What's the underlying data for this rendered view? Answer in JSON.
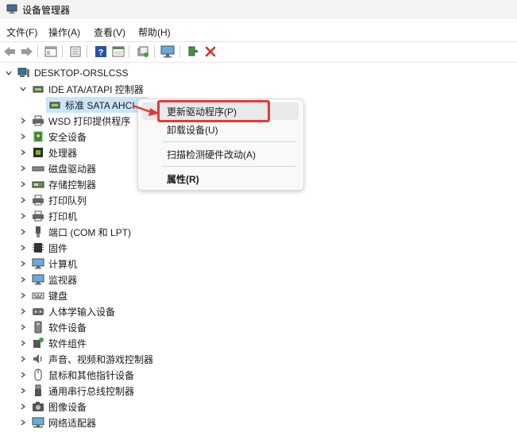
{
  "window": {
    "title": "设备管理器"
  },
  "menubar": {
    "items": [
      "文件(F)",
      "操作(A)",
      "查看(V)",
      "帮助(H)"
    ]
  },
  "toolbar": {
    "buttons": [
      "back-icon",
      "forward-icon",
      "properties-icon",
      "list-icon",
      "help-icon",
      "view-icon",
      "scan-icon",
      "monitor-icon",
      "enable-driver-icon",
      "uninstall-icon"
    ]
  },
  "tree": {
    "root": "DESKTOP-ORSLCSS",
    "ide_category": "IDE ATA/ATAPI 控制器",
    "ide_child": "标准 SATA AHCI",
    "categories": [
      "WSD 打印提供程序",
      "安全设备",
      "处理器",
      "磁盘驱动器",
      "存储控制器",
      "打印队列",
      "打印机",
      "端口 (COM 和 LPT)",
      "固件",
      "计算机",
      "监视器",
      "键盘",
      "人体学输入设备",
      "软件设备",
      "软件组件",
      "声音、视频和游戏控制器",
      "鼠标和其他指针设备",
      "通用串行总线控制器",
      "图像设备",
      "网络适配器"
    ]
  },
  "context_menu": {
    "items": [
      "更新驱动程序(P)",
      "卸载设备(U)",
      "扫描检测硬件改动(A)",
      "属性(R)"
    ]
  },
  "colors": {
    "accent_red": "#e53935",
    "selection": "#cce4f7",
    "uninstall_red": "#d32f2f"
  }
}
